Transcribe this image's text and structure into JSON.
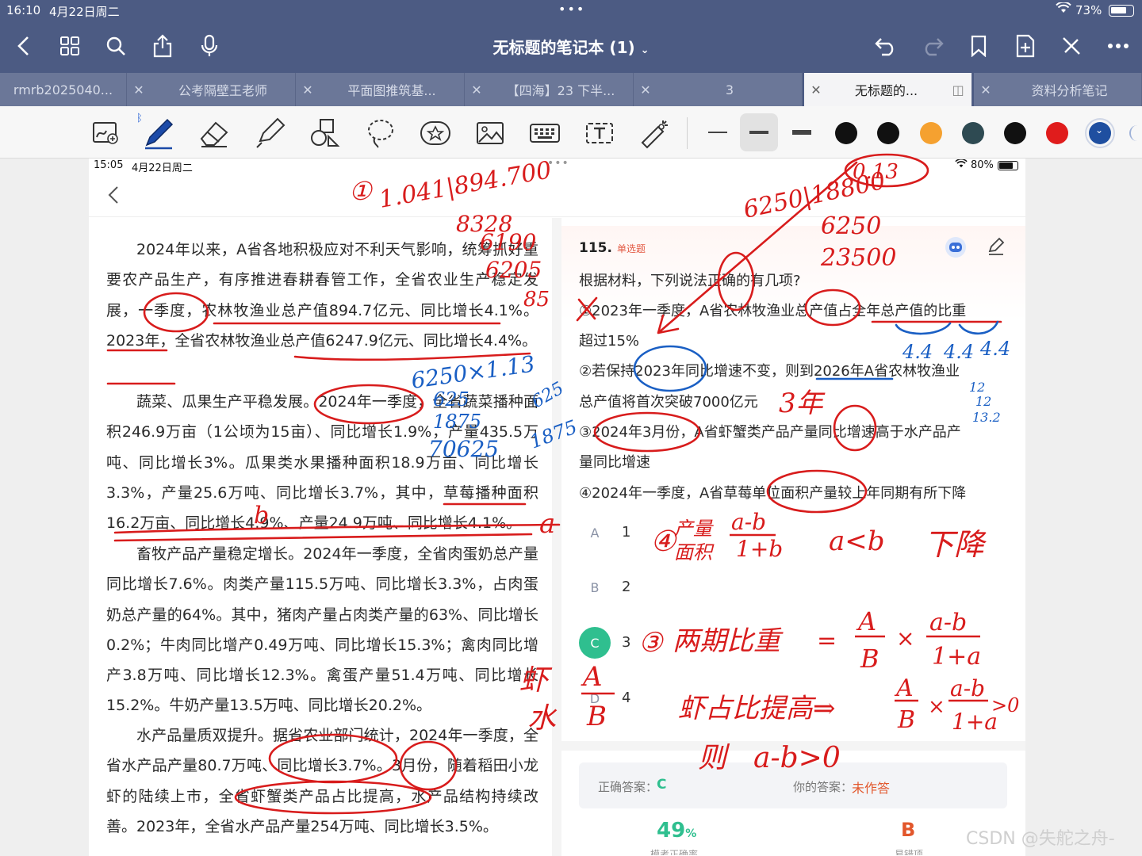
{
  "status": {
    "time": "16:10",
    "date": "4月22日周二",
    "battery": "73%",
    "battery_level": 0.73
  },
  "app": {
    "title": "无标题的笔记本 (1)"
  },
  "tabs": [
    {
      "label": "rmrb2025040..."
    },
    {
      "label": "公考隔壁王老师"
    },
    {
      "label": "平面图推筑基..."
    },
    {
      "label": "【四海】23 下半..."
    },
    {
      "label": "3"
    },
    {
      "label": "无标题的..."
    },
    {
      "label": "资料分析笔记"
    }
  ],
  "toolbar": {
    "tools": [
      "image-add-icon",
      "pen-icon",
      "eraser-icon",
      "highlighter-icon",
      "shapes-icon",
      "lasso-icon",
      "sticker-icon",
      "image-icon",
      "keyboard-icon",
      "text-icon",
      "laser-pointer-icon"
    ],
    "colors": [
      "#111111",
      "#111111",
      "#f5a130",
      "#2e4a52",
      "#111111",
      "#e01c1c",
      "#1f4fa0"
    ]
  },
  "inner": {
    "status_time": "15:05",
    "status_date": "4月22日周二",
    "battery": "80%",
    "battery_level": 0.8
  },
  "passage": [
    "2024年以来，A省各地积极应对不利天气影响，统筹抓好重要农产品生产，有序推进春耕春管工作，全省农业生产稳定发展，一季度，农林牧渔业总产值894.7亿元、同比增长4.1%。2023年，全省农林牧渔业总产值6247.9亿元、同比增长4.4%。",
    "蔬菜、瓜果生产平稳发展。2024年一季度，全省蔬菜播种面积246.9万亩（1公顷为15亩）、同比增长1.9%，产量435.5万吨、同比增长3%。瓜果类水果播种面积18.9万亩、同比增长3.3%，产量25.6万吨、同比增长3.7%，其中，草莓播种面积16.2万亩、同比增长4.9%、产量24.9万吨、同比增长4.1%。",
    "畜牧产品产量稳定增长。2024年一季度，全省肉蛋奶总产量同比增长7.6%。肉类产量115.5万吨、同比增长3.3%，占肉蛋奶总产量的64%。其中，猪肉产量占肉类产量的63%、同比增长0.2%；牛肉同比增产0.49万吨、同比增长15.3%；禽肉同比增产3.8万吨、同比增长12.3%。禽蛋产量51.4万吨、同比增长15.2%。牛奶产量13.5万吨、同比增长20.2%。",
    "水产品量质双提升。据省农业部门统计，2024年一季度，全省水产品产量80.7万吨、同比增长3.7%。3月份，随着稻田小龙虾的陆续上市，全省虾蟹类产品占比提高，水产品结构持续改善。2023年，全省水产品产量254万吨、同比增长3.5%。"
  ],
  "question": {
    "number": "115.",
    "type": "单选题",
    "stem": "根据材料，下列说法正确的有几项?",
    "statements": [
      "①2023年一季度，A省农林牧渔业总产值占全年总产值的比重",
      "超过15%",
      "②若保持2023年同比增速不变，则到2026年A省农林牧渔业",
      "总产值将首次突破7000亿元",
      "③2024年3月份，A省虾蟹类产品产量同比增速高于水产品产",
      "量同比增速",
      "④2024年一季度，A省草莓单位面积产量较上年同期有所下降"
    ],
    "options": [
      {
        "letter": "A",
        "value": "1"
      },
      {
        "letter": "B",
        "value": "2"
      },
      {
        "letter": "C",
        "value": "3"
      },
      {
        "letter": "D",
        "value": "4"
      }
    ],
    "correct_label": "正确答案：",
    "correct_value": "C",
    "your_label": "你的答案：",
    "your_value": "未作答",
    "stat_rate": "49",
    "stat_rate_unit": "%",
    "stat_rate_label": "模考正确率",
    "stat_wrong": "B",
    "stat_wrong_label": "易错项"
  },
  "handwriting": {
    "n1": "①",
    "calc1": "1.041|894.700",
    "c1a": "8328",
    "c1b": "6190",
    "c1c": "6205",
    "c1d": "85",
    "top_div": "6250|18800",
    "top_div_b": "6250",
    "top_div_c": "23500",
    "top_res": "0.13",
    "mult": "6250×1.13",
    "m1": "625",
    "m2": "1875",
    "m3": "70625",
    "m4": "625",
    "m5": "1875",
    "y3": "3年",
    "f1": "4.4",
    "f2": "4.4",
    "f3": "4.4",
    "f4": "12",
    "f5": "12",
    "f6": "13.2",
    "a_mark": "a",
    "b_mark": "b",
    "s4": "④",
    "chan": "产量",
    "mian": "面积",
    "frac1n": "a-b",
    "frac1d": "1+b",
    "altb": "a<b",
    "xiajiang": "下降",
    "s3": "③",
    "liangqi": "两期比重",
    "eq": "=",
    "frA": "A",
    "frB": "B",
    "times": "×",
    "frn": "a-b",
    "frd": "1+a",
    "xia": "虾",
    "shui": "水",
    "xA": "A",
    "xB": "B",
    "xiabi": "虾占比提高⇒",
    "fA2": "A",
    "fB2": "B",
    "times2": "×",
    "fn2": "a-b",
    "fd2": "1+a",
    "gt0": ">0",
    "ze": "则",
    "abgt0": "a-b>0"
  },
  "watermark": "CSDN @失舵之舟-"
}
